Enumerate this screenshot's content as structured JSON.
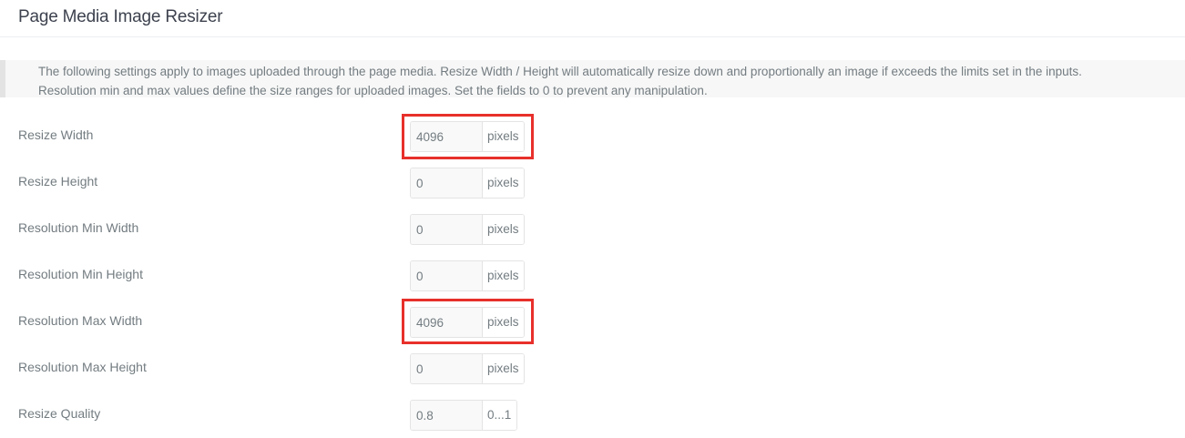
{
  "page": {
    "title": "Page Media Image Resizer"
  },
  "notice": {
    "line1": "The following settings apply to images uploaded through the page media. Resize Width / Height will automatically resize down and proportionally an image if exceeds the limits set in the inputs.",
    "line2": "Resolution min and max values define the size ranges for uploaded images. Set the fields to 0 to prevent any manipulation."
  },
  "fields": [
    {
      "label": "Resize Width",
      "value": "4096",
      "unit": "pixels",
      "highlighted": true
    },
    {
      "label": "Resize Height",
      "value": "0",
      "unit": "pixels",
      "highlighted": false
    },
    {
      "label": "Resolution Min Width",
      "value": "0",
      "unit": "pixels",
      "highlighted": false
    },
    {
      "label": "Resolution Min Height",
      "value": "0",
      "unit": "pixels",
      "highlighted": false
    },
    {
      "label": "Resolution Max Width",
      "value": "4096",
      "unit": "pixels",
      "highlighted": true
    },
    {
      "label": "Resolution Max Height",
      "value": "0",
      "unit": "pixels",
      "highlighted": false
    },
    {
      "label": "Resize Quality",
      "value": "0.8",
      "unit": "0...1",
      "highlighted": false
    }
  ],
  "colors": {
    "highlight": "#e8302b",
    "title": "#3d424e",
    "text": "#737c81"
  }
}
